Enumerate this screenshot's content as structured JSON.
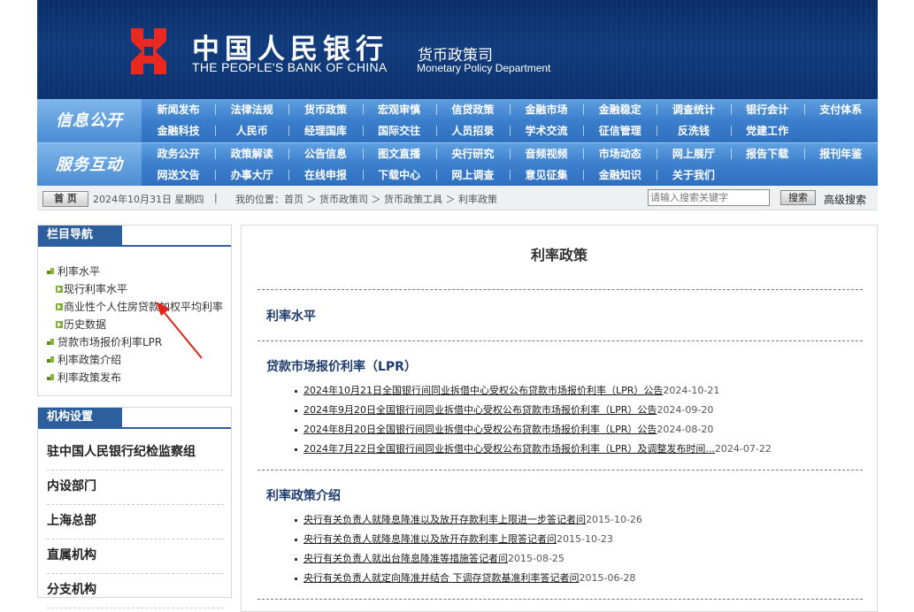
{
  "header": {
    "bank_cn": "中国人民银行",
    "bank_en": "THE PEOPLE'S BANK OF CHINA",
    "dept_cn": "货币政策司",
    "dept_en": "Monetary Policy Department",
    "brand_color": "#0e3873"
  },
  "nav": {
    "row1_label": "信息公开",
    "row1_items": [
      "新闻发布",
      "法律法规",
      "货币政策",
      "宏观审慎",
      "信贷政策",
      "金融市场",
      "金融稳定",
      "调查统计",
      "银行会计",
      "支付体系",
      "金融科技",
      "人民币",
      "经理国库",
      "国际交往",
      "人员招录",
      "学术交流",
      "征信管理",
      "反洗钱",
      "党建工作"
    ],
    "row2_label": "服务互动",
    "row2_items": [
      "政务公开",
      "政策解读",
      "公告信息",
      "图文直播",
      "央行研究",
      "音频视频",
      "市场动态",
      "网上展厅",
      "报告下载",
      "报刊年鉴",
      "网送文告",
      "办事大厅",
      "在线申报",
      "下载中心",
      "网上调查",
      "意见征集",
      "金融知识",
      "关于我们"
    ]
  },
  "infobar": {
    "home_label": "首 页",
    "date": "2024年10月31日 星期四",
    "divider": "|",
    "location": "我的位置：首页 ＞ 货币政策司 ＞ 货币政策工具 ＞ 利率政策",
    "search_placeholder": "请输入搜索关键字",
    "search_button": "搜索",
    "advanced_search": "高级搜索"
  },
  "sidebar": {
    "nav_title": "栏目导航",
    "tree": [
      {
        "label": "利率水平",
        "level": 1
      },
      {
        "label": "现行利率水平",
        "level": 2
      },
      {
        "label": "商业性个人住房贷款加权平均利率",
        "level": 2
      },
      {
        "label": "历史数据",
        "level": 2
      },
      {
        "label": "贷款市场报价利率LPR",
        "level": 1
      },
      {
        "label": "利率政策介绍",
        "level": 1
      },
      {
        "label": "利率政策发布",
        "level": 1
      }
    ],
    "org_title": "机构设置",
    "orgs": [
      "驻中国人民银行纪检监察组",
      "内设部门",
      "上海总部",
      "直属机构",
      "分支机构"
    ]
  },
  "main": {
    "title": "利率政策",
    "sections": [
      {
        "heading": "利率水平",
        "items": []
      },
      {
        "heading": "贷款市场报价利率（LPR）",
        "items": [
          {
            "title": "2024年10月21日全国银行间同业拆借中心受权公布贷款市场报价利率（LPR）公告",
            "date": "2024-10-21"
          },
          {
            "title": "2024年9月20日全国银行间同业拆借中心受权公布贷款市场报价利率（LPR）公告",
            "date": "2024-09-20"
          },
          {
            "title": "2024年8月20日全国银行间同业拆借中心受权公布贷款市场报价利率（LPR）公告",
            "date": "2024-08-20"
          },
          {
            "title": "2024年7月22日全国银行间同业拆借中心受权公布贷款市场报价利率（LPR）及调整发布时间...",
            "date": "2024-07-22"
          }
        ]
      },
      {
        "heading": "利率政策介绍",
        "items": [
          {
            "title": "央行有关负责人就降息降准以及放开存款利率上限进一步答记者问",
            "date": "2015-10-26"
          },
          {
            "title": "央行有关负责人就降息降准以及放开存款利率上限答记者问",
            "date": "2015-10-23"
          },
          {
            "title": "央行有关负责人就出台降息降准等措施答记者问",
            "date": "2015-08-25"
          },
          {
            "title": "央行有关负责人就定向降准并结合 下调存贷款基准利率答记者问",
            "date": "2015-06-28"
          }
        ]
      }
    ]
  }
}
